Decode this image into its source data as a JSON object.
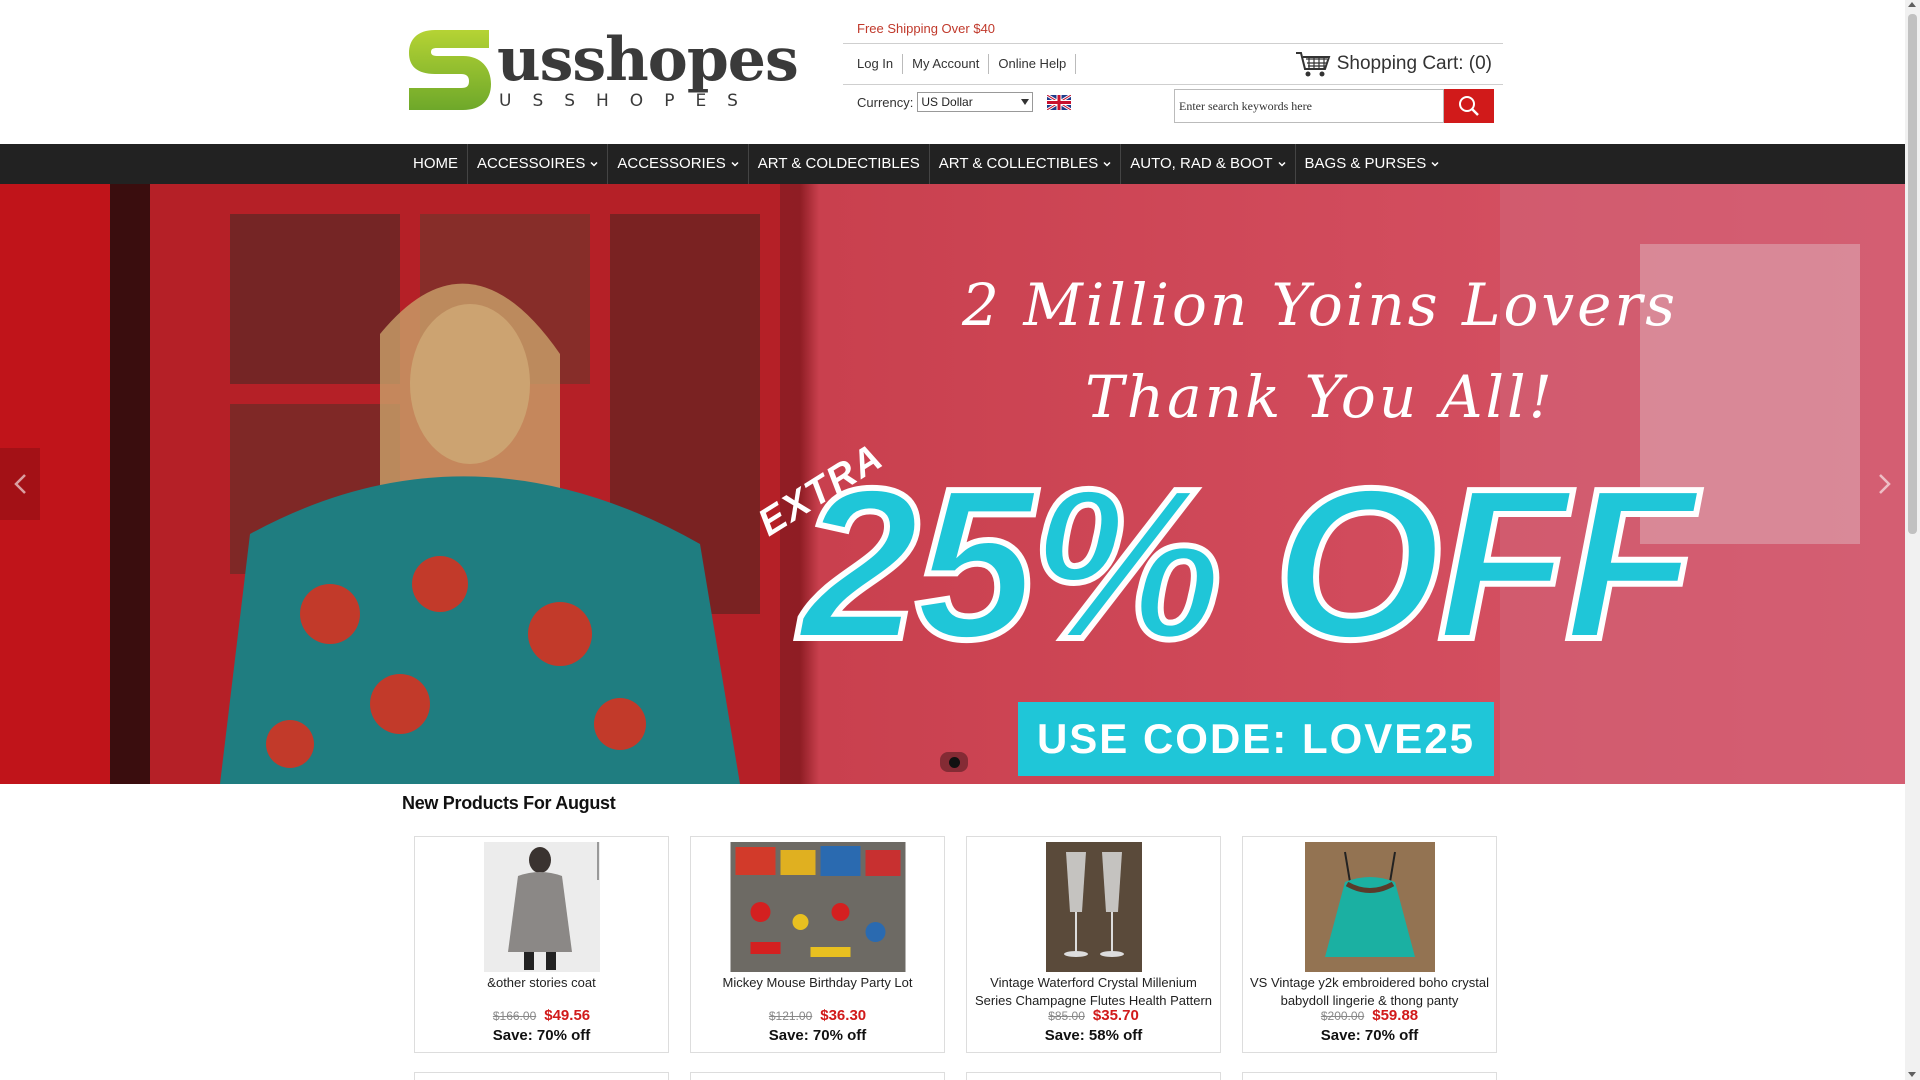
{
  "brand": {
    "name": "usshopes",
    "tagline": "USSHOPES"
  },
  "topbar": {
    "free_shipping": "Free Shipping Over $40",
    "links": [
      "Log In",
      "My Account",
      "Online Help"
    ],
    "cart_label": "Shopping Cart: (0)",
    "currency_label": "Currency:",
    "currency_value": "US Dollar"
  },
  "search": {
    "placeholder": "Enter search keywords here"
  },
  "nav": {
    "items": [
      {
        "label": "HOME",
        "dropdown": false
      },
      {
        "label": "ACCESSOIRES",
        "dropdown": true
      },
      {
        "label": "ACCESSORIES",
        "dropdown": true
      },
      {
        "label": "ART & COLDECTIBLES",
        "dropdown": false
      },
      {
        "label": "ART & COLLECTIBLES",
        "dropdown": true
      },
      {
        "label": "AUTO, RAD & BOOT",
        "dropdown": true
      },
      {
        "label": "BAGS & PURSES",
        "dropdown": true
      }
    ]
  },
  "hero": {
    "headline_line1": "2 Million Yoins Lovers",
    "headline_line2": "Thank You All!",
    "extra": "EXTRA",
    "discount": "25% OFF",
    "code": "USE CODE: LOVE25"
  },
  "products_section": {
    "title": "New Products For August",
    "items": [
      {
        "name": "&other stories coat",
        "old_price": "$166.00",
        "new_price": "$49.56",
        "save": "Save: 70% off"
      },
      {
        "name": "Mickey Mouse Birthday Party Lot",
        "old_price": "$121.00",
        "new_price": "$36.30",
        "save": "Save: 70% off"
      },
      {
        "name": "Vintage Waterford Crystal Millenium Series Champagne Flutes Health Pattern",
        "old_price": "$85.00",
        "new_price": "$35.70",
        "save": "Save: 58% off"
      },
      {
        "name": "VS Vintage y2k embroidered boho crystal babydoll lingerie & thong panty",
        "old_price": "$200.00",
        "new_price": "$59.88",
        "save": "Save: 70% off"
      }
    ]
  },
  "colors": {
    "accent_red": "#d11a1a",
    "nav_bg": "#222222",
    "hero_cyan": "#1fc6d8",
    "logo_green": "#8dc63f"
  }
}
